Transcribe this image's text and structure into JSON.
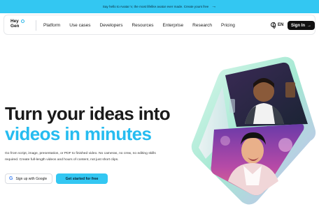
{
  "announcement": {
    "text": "Say hello to Avatar V, the most lifelike avatar ever made. Create yours free"
  },
  "logo": {
    "line1": "Hey",
    "line2": "Gen"
  },
  "nav": {
    "items": [
      "Platform",
      "Use cases",
      "Developers",
      "Resources",
      "Enterprise",
      "Research",
      "Pricing"
    ],
    "language": "EN",
    "signin_label": "Sign In"
  },
  "hero": {
    "headline_line1": "Turn your ideas into",
    "headline_line2": "videos in minutes",
    "description": "Go from script, image, presentation, or PDF to finished video. No cameras, no crew, no editing skills required. Create full-length videos and hours of content, not just short clips."
  },
  "cta": {
    "google_label": "Sign up with Google",
    "start_label": "Get started for free"
  },
  "colors": {
    "accent": "#33c7f2",
    "accent_text": "#26bcf0"
  }
}
